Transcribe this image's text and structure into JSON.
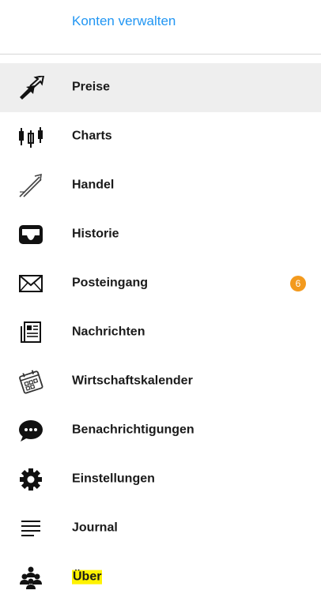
{
  "header": {
    "manage_accounts": "Konten verwalten"
  },
  "menu": {
    "items": [
      {
        "label": "Preise",
        "icon": "quotes-arrows-icon",
        "selected": true
      },
      {
        "label": "Charts",
        "icon": "candlestick-icon"
      },
      {
        "label": "Handel",
        "icon": "trade-icon"
      },
      {
        "label": "Historie",
        "icon": "history-tray-icon"
      },
      {
        "label": "Posteingang",
        "icon": "envelope-icon",
        "badge": "6"
      },
      {
        "label": "Nachrichten",
        "icon": "newspaper-icon"
      },
      {
        "label": "Wirtschaftskalender",
        "icon": "calendar-icon"
      },
      {
        "label": "Benachrichtigungen",
        "icon": "chat-bubble-icon"
      },
      {
        "label": "Einstellungen",
        "icon": "gear-icon"
      },
      {
        "label": "Journal",
        "icon": "journal-lines-icon"
      },
      {
        "label": "Über",
        "icon": "community-icon",
        "highlighted": true
      }
    ]
  },
  "colors": {
    "link": "#2196f3",
    "badge": "#f39a1e",
    "selected_bg": "#eeeeee",
    "highlight": "#fff200"
  }
}
